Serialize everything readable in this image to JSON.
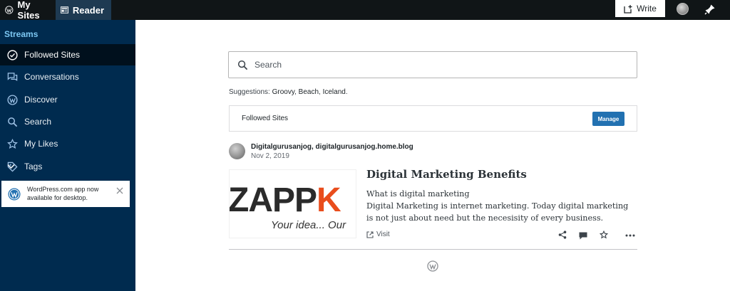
{
  "topbar": {
    "my_sites": "My Sites",
    "reader": "Reader",
    "write": "Write"
  },
  "sidebar": {
    "heading": "Streams",
    "items": [
      {
        "label": "Followed Sites",
        "icon": "checkmark-circle-icon"
      },
      {
        "label": "Conversations",
        "icon": "chat-bubbles-icon"
      },
      {
        "label": "Discover",
        "icon": "wordpress-icon"
      },
      {
        "label": "Search",
        "icon": "search-icon"
      },
      {
        "label": "My Likes",
        "icon": "star-icon"
      },
      {
        "label": "Tags",
        "icon": "tag-icon"
      }
    ],
    "notice": "WordPress.com app now available for desktop."
  },
  "search": {
    "placeholder": "Search",
    "suggestions_label": "Suggestions:",
    "suggestions": [
      "Groovy",
      "Beach",
      "Iceland"
    ]
  },
  "followed_header": {
    "title": "Followed Sites",
    "manage_label": "Manage"
  },
  "post": {
    "site": "Digitalgurusanjog, digitalgurusanjog.home.blog",
    "date": "Nov 2, 2019",
    "image_text_main": "ZAPPK",
    "image_text_tagline": "Your idea... Our",
    "title": "Digital Marketing Benefits",
    "excerpt_line1": "What is digital marketing",
    "excerpt_line2": "Digital Marketing is internet marketing. Today digital marketing is not just about need but the necesisity of every business.",
    "visit_label": "Visit"
  },
  "colors": {
    "topbar": "#101517",
    "sidebar": "#002b4f",
    "sidebar_active": "#00101d",
    "accent": "#2271b1",
    "streams_heading": "#7cc7f2"
  }
}
